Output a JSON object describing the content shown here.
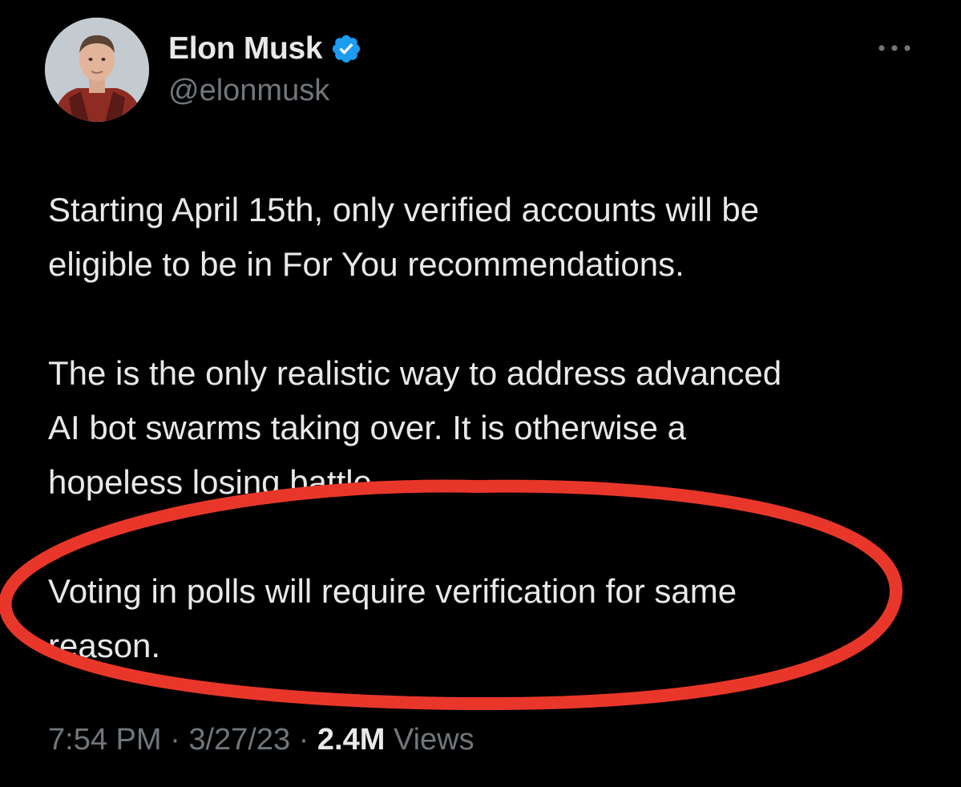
{
  "author": {
    "display_name": "Elon Musk",
    "handle": "@elonmusk",
    "verified": true,
    "avatar_icon": "avatar-photo"
  },
  "tweet": {
    "paragraphs": [
      [
        "Starting April 15th, only verified accounts will be",
        "eligible to be in For You recommendations."
      ],
      [
        "The is the only realistic way to address advanced",
        "AI bot swarms taking over. It is otherwise a",
        "hopeless losing battle."
      ],
      [
        "Voting in polls will require verification for same",
        "reason."
      ]
    ]
  },
  "meta": {
    "time": "7:54 PM",
    "separator": "·",
    "date": "3/27/23",
    "views_count": "2.4M",
    "views_label": "Views"
  },
  "icons": {
    "more": "more-horizontal-icon",
    "verified": "verified-badge-icon"
  },
  "colors": {
    "background": "#000000",
    "text_primary": "#e7e9ea",
    "text_secondary": "#71767b",
    "verified_blue": "#1d9bf0",
    "highlight_red": "#e8372a"
  }
}
